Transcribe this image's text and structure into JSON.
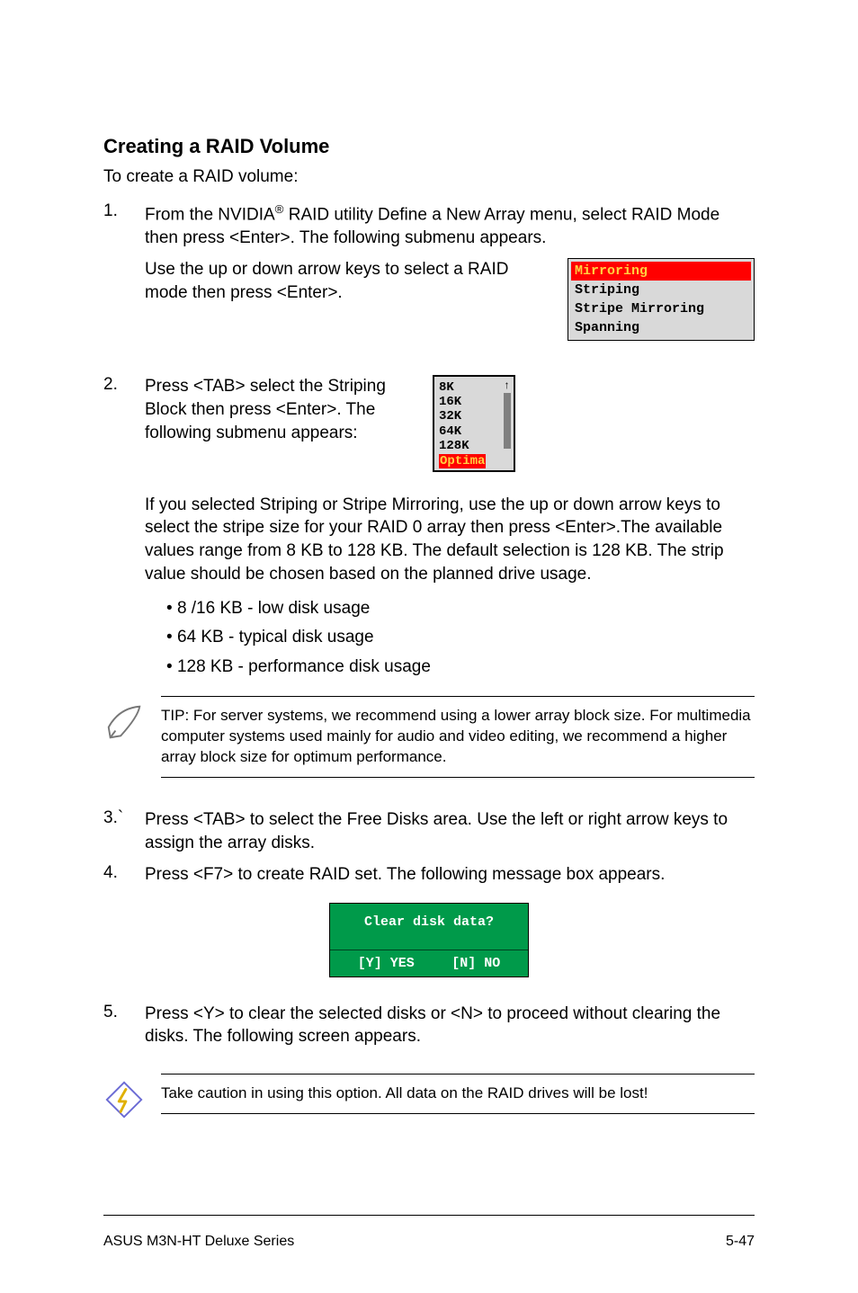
{
  "heading": "Creating a RAID Volume",
  "intro": "To create a RAID volume:",
  "step1": {
    "num": "1.",
    "para1_a": "From the NVIDIA",
    "para1_sup": "®",
    "para1_b": " RAID utility Define a New Array menu, select RAID Mode then press <Enter>. The following submenu appears.",
    "para2": "Use the up or down arrow keys to select a RAID mode then press <Enter>."
  },
  "raid_modes": {
    "selected": "Mirroring",
    "opts": [
      "Striping",
      "Stripe Mirroring",
      "Spanning"
    ]
  },
  "step2": {
    "num": "2.",
    "para1": "Press <TAB> select the Striping Block then press <Enter>. The following submenu appears:",
    "para2": "If you selected Striping or Stripe Mirroring, use the up or down arrow keys to select the stripe size for your RAID 0 array then press <Enter>.The available values range from 8 KB to 128 KB. The default selection is 128 KB. The strip value should be chosen based on the planned drive usage."
  },
  "stripe_sizes": {
    "opts": [
      "8K",
      "16K",
      "32K",
      "64K",
      "128K"
    ],
    "selected": "Optima"
  },
  "bullets": [
    "8 /16 KB - low disk usage",
    "64 KB - typical disk usage",
    "128 KB - performance disk usage"
  ],
  "tip": "TIP: For server systems, we recommend using a lower array block size. For multimedia computer systems used mainly for audio and video editing, we recommend a higher array block size for optimum performance.",
  "step3": {
    "num": "3.`",
    "text": "Press <TAB> to select the Free Disks area. Use the left or right arrow keys to assign the array disks."
  },
  "step4": {
    "num": "4.",
    "text": "Press <F7> to create RAID set. The following message box appears."
  },
  "msgbox": {
    "title": "Clear disk data?",
    "yes": "[Y] YES",
    "no": "[N] NO"
  },
  "step5": {
    "num": "5.",
    "text": "Press <Y> to clear the selected disks or <N> to proceed without clearing the disks. The following screen appears."
  },
  "caution": "Take caution in using this option. All data on the RAID drives will be lost!",
  "footer": {
    "left": "ASUS M3N-HT Deluxe Series",
    "right": "5-47"
  }
}
